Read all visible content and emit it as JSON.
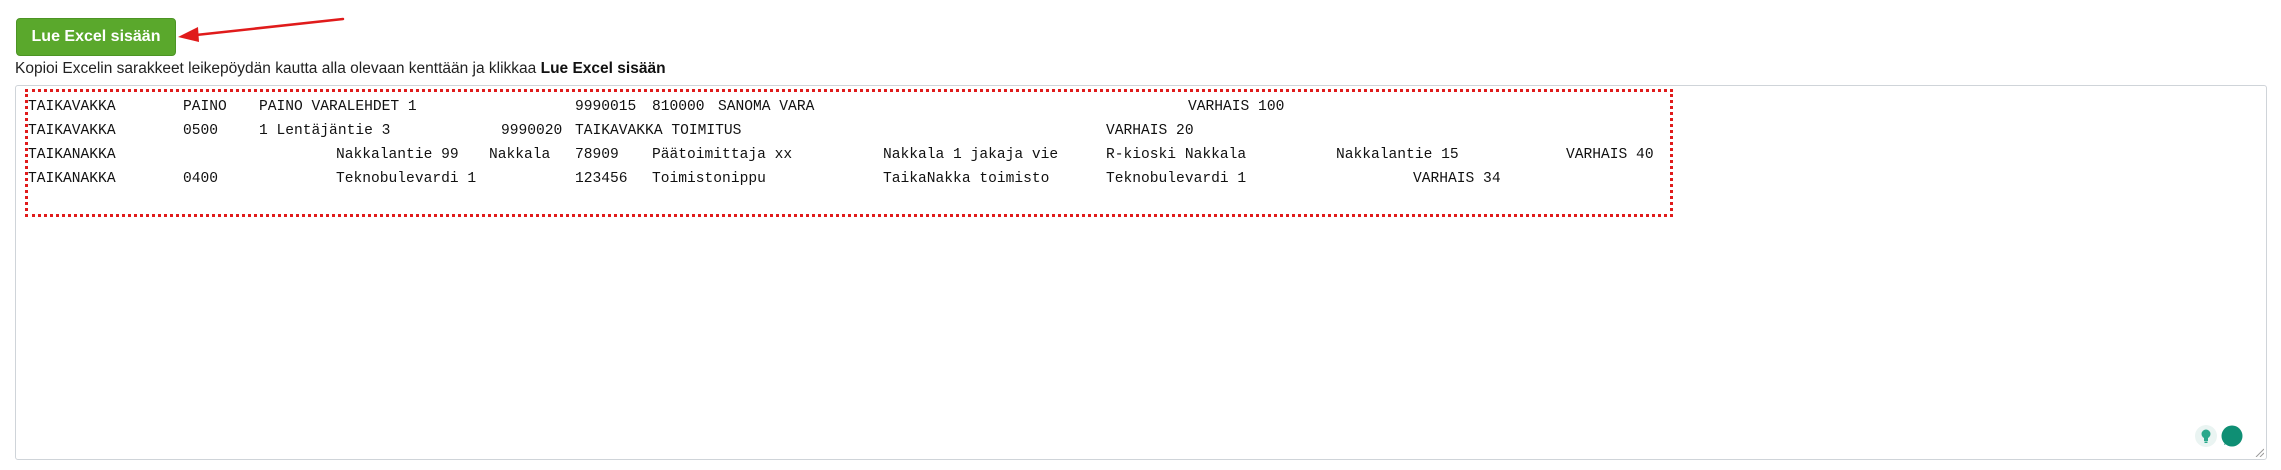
{
  "toolbar": {
    "read_button_label": "Lue Excel sisään"
  },
  "instructions": {
    "text": "Kopioi Excelin sarakkeet leikepöydän kautta alla olevaan kenttään ja klikkaa ",
    "bold": "Lue Excel sisään"
  },
  "paste_area": {
    "rows": [
      [
        "TAIKAVAKKA",
        "PAINO",
        "PAINO VARALEHDET 1",
        "9990015",
        "810000",
        "SANOMA VARA",
        "",
        "",
        "",
        "VARHAIS 100"
      ],
      [
        "TAIKAVAKKA",
        "0500",
        "1 Lentäjäntie 3",
        "9990020",
        "TAIKAVAKKA TOIMITUS",
        "",
        "",
        "VARHAIS 20",
        "",
        ""
      ],
      [
        "TAIKANAKKA",
        "",
        "Nakkalantie 99",
        "Nakkala",
        "78909",
        "Päätoimittaja xx",
        "Nakkala 1 jakaja vie",
        "R-kioski Nakkala",
        "Nakkalantie 15",
        "VARHAIS 40"
      ],
      [
        "TAIKANAKKA",
        "0400",
        "Teknobulevardi 1",
        "123456",
        "Toimistonippu",
        "TaikaNakka toimisto",
        "Teknobulevardi 1",
        "VARHAIS 34",
        "",
        ""
      ]
    ]
  },
  "colors": {
    "button_green": "#5aa82c",
    "annotation_red": "#e01b1b",
    "widget_teal": "#0f8f74"
  },
  "icons": {
    "annotation": "red-arrow-icon",
    "widget": [
      "lightbulb-icon",
      "chat-bubble-icon"
    ]
  }
}
